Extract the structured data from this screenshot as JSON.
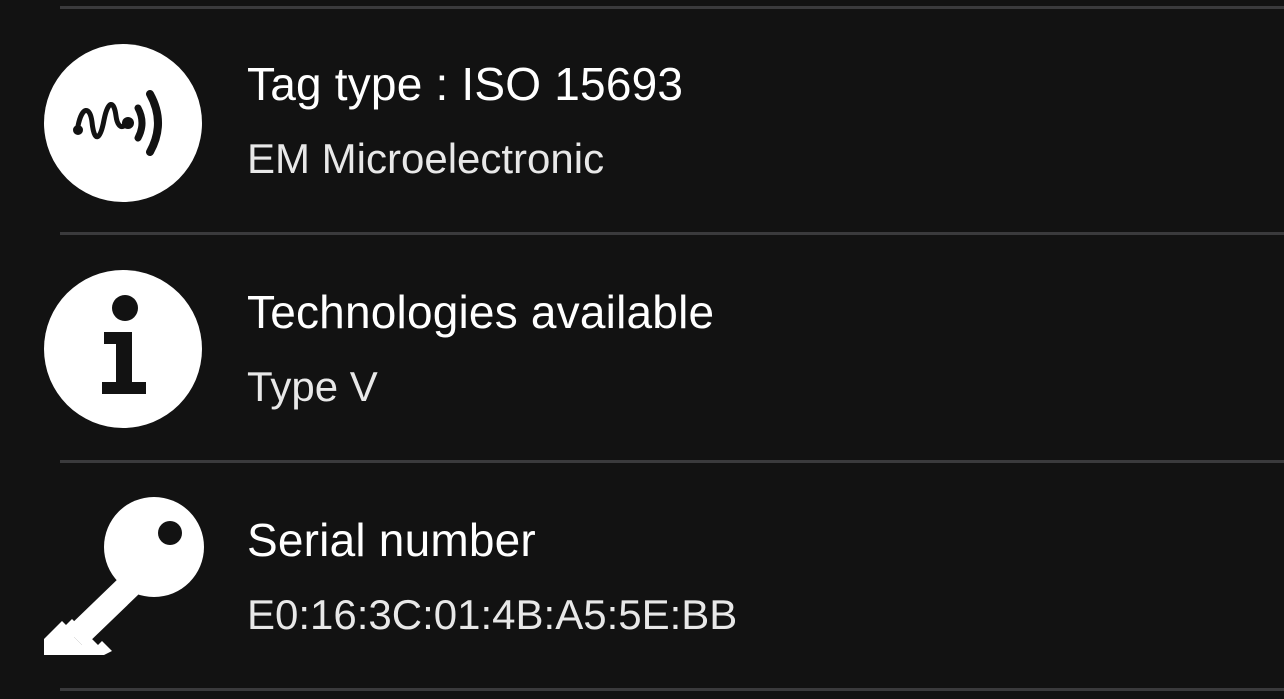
{
  "rows": [
    {
      "title": "Tag type : ISO 15693",
      "subtitle": "EM Microelectronic",
      "icon": "nfc-tag-icon"
    },
    {
      "title": "Technologies available",
      "subtitle": "Type V",
      "icon": "info-icon"
    },
    {
      "title": "Serial number",
      "subtitle": "E0:16:3C:01:4B:A5:5E:BB",
      "icon": "key-icon"
    }
  ],
  "colors": {
    "background": "#121212",
    "divider": "#3a3a3c",
    "text": "#ffffff",
    "icon": "#ffffff"
  }
}
